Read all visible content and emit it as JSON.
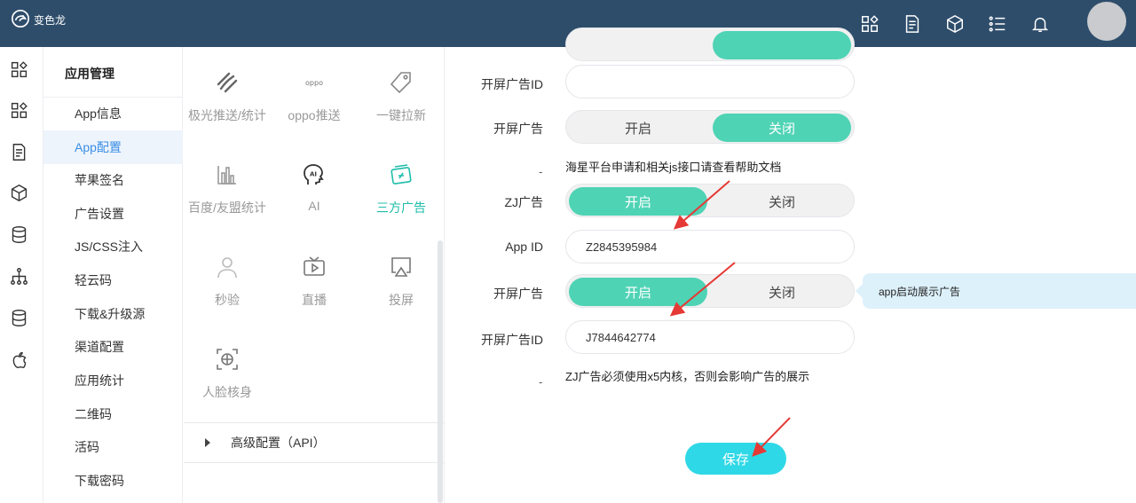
{
  "app": {
    "brand_name": "变色龙"
  },
  "topbar": {
    "icons": [
      "apps-grid-icon",
      "document-icon",
      "cube-icon",
      "list-icon",
      "bell-icon"
    ]
  },
  "menu": {
    "title": "应用管理",
    "items": [
      {
        "label": "App信息",
        "active": false
      },
      {
        "label": "App配置",
        "active": true
      },
      {
        "label": "苹果签名",
        "active": false
      },
      {
        "label": "广告设置",
        "active": false
      },
      {
        "label": "JS/CSS注入",
        "active": false
      },
      {
        "label": "轻云码",
        "active": false
      },
      {
        "label": "下载&升级源",
        "active": false
      },
      {
        "label": "渠道配置",
        "active": false
      },
      {
        "label": "应用统计",
        "active": false
      },
      {
        "label": "二维码",
        "active": false
      },
      {
        "label": "活码",
        "active": false
      },
      {
        "label": "下载密码",
        "active": false
      }
    ]
  },
  "modules": {
    "items": [
      {
        "label": "极光推送/统计",
        "icon": "jpush-icon"
      },
      {
        "label": "oppo推送",
        "icon": "oppo-logo-icon",
        "logo_text": "oppo"
      },
      {
        "label": "一键拉新",
        "icon": "tag-icon"
      },
      {
        "label": "百度/友盟统计",
        "icon": "bar-chart-icon"
      },
      {
        "label": "AI",
        "icon": "ai-head-icon",
        "logo_text": "AI"
      },
      {
        "label": "三方广告",
        "icon": "ad-card-icon",
        "active": true
      },
      {
        "label": "秒验",
        "icon": "user-icon"
      },
      {
        "label": "直播",
        "icon": "tv-icon"
      },
      {
        "label": "投屏",
        "icon": "cast-icon"
      },
      {
        "label": "人脸核身",
        "icon": "face-scan-icon"
      }
    ],
    "advanced_label": "高级配置（API）"
  },
  "form": {
    "splash_ad_id_label_1": "开屏广告ID",
    "splash_ad_id_value_1": "",
    "splash_ad_label_1": "开屏广告",
    "toggle_on": "开启",
    "toggle_off": "关闭",
    "haixing_note_dash": "-",
    "haixing_note": "海星平台申请和相关js接口请查看帮助文档",
    "zj_ad_label": "ZJ广告",
    "app_id_label": "App ID",
    "app_id_value": "Z2845395984",
    "splash_ad_label_2": "开屏广告",
    "splash_tip": "app启动展示广告",
    "splash_ad_id_label_2": "开屏广告ID",
    "splash_ad_id_value_2": "J7844642774",
    "zj_note_dash": "-",
    "zj_note": "ZJ广告必须使用x5内核，否则会影响广告的展示",
    "save_label": "保存"
  },
  "colors": {
    "topbar": "#2e4d6b",
    "toggle_on": "#4fd3b5",
    "save_button": "#2fd8e6",
    "active_menu_text": "#3a8ee6",
    "active_module_text": "#1fbdaa",
    "annotation_arrow": "#e53935"
  }
}
